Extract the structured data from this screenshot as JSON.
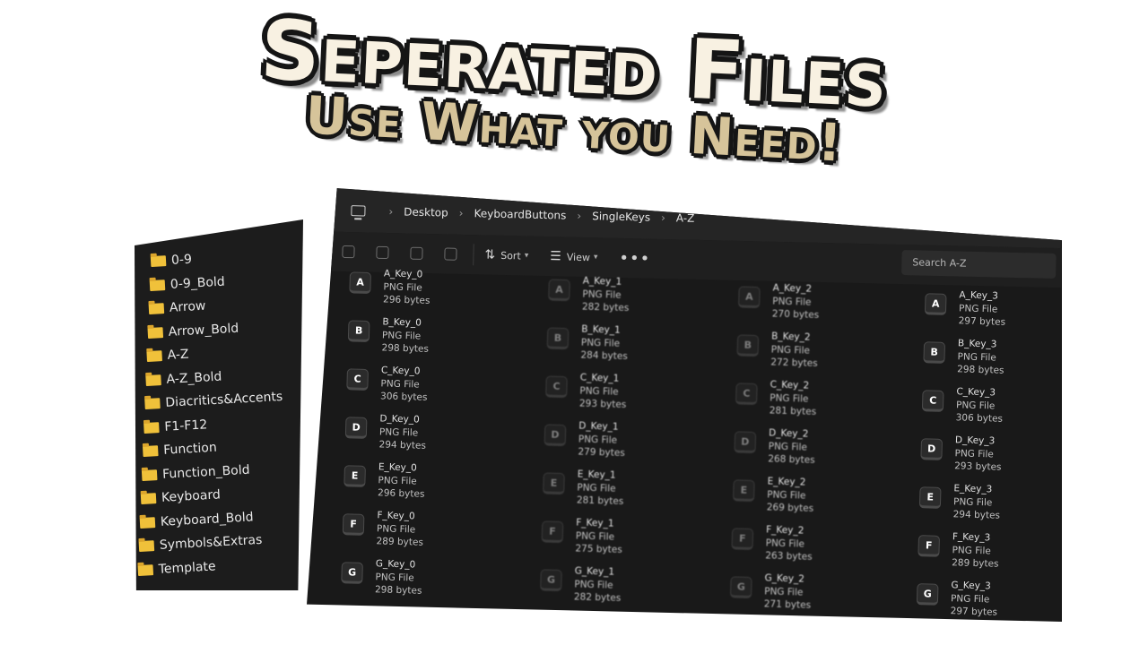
{
  "headline": {
    "title": "Seperated Files",
    "subtitle": "Use What you Need!"
  },
  "folders": [
    "0-9",
    "0-9_Bold",
    "Arrow",
    "Arrow_Bold",
    "A-Z",
    "A-Z_Bold",
    "Diacritics&Accents",
    "F1-F12",
    "Function",
    "Function_Bold",
    "Keyboard",
    "Keyboard_Bold",
    "Symbols&Extras",
    "Template"
  ],
  "explorer": {
    "breadcrumb": [
      "Desktop",
      "KeyboardButtons",
      "SingleKeys",
      "A-Z"
    ],
    "toolbar": {
      "sort": "Sort",
      "view": "View",
      "more": "•••"
    },
    "search_placeholder": "Search A-Z",
    "columns": [
      {
        "files": [
          {
            "letter": "A",
            "name": "A_Key_0",
            "type": "PNG File",
            "size": "296 bytes"
          },
          {
            "letter": "B",
            "name": "B_Key_0",
            "type": "PNG File",
            "size": "298 bytes"
          },
          {
            "letter": "C",
            "name": "C_Key_0",
            "type": "PNG File",
            "size": "306 bytes"
          },
          {
            "letter": "D",
            "name": "D_Key_0",
            "type": "PNG File",
            "size": "294 bytes"
          },
          {
            "letter": "E",
            "name": "E_Key_0",
            "type": "PNG File",
            "size": "296 bytes"
          },
          {
            "letter": "F",
            "name": "F_Key_0",
            "type": "PNG File",
            "size": "289 bytes"
          },
          {
            "letter": "G",
            "name": "G_Key_0",
            "type": "PNG File",
            "size": "298 bytes"
          }
        ]
      },
      {
        "files": [
          {
            "letter": "A",
            "name": "A_Key_1",
            "type": "PNG File",
            "size": "282 bytes"
          },
          {
            "letter": "B",
            "name": "B_Key_1",
            "type": "PNG File",
            "size": "284 bytes"
          },
          {
            "letter": "C",
            "name": "C_Key_1",
            "type": "PNG File",
            "size": "293 bytes"
          },
          {
            "letter": "D",
            "name": "D_Key_1",
            "type": "PNG File",
            "size": "279 bytes"
          },
          {
            "letter": "E",
            "name": "E_Key_1",
            "type": "PNG File",
            "size": "281 bytes"
          },
          {
            "letter": "F",
            "name": "F_Key_1",
            "type": "PNG File",
            "size": "275 bytes"
          },
          {
            "letter": "G",
            "name": "G_Key_1",
            "type": "PNG File",
            "size": "282 bytes"
          }
        ]
      },
      {
        "files": [
          {
            "letter": "A",
            "name": "A_Key_2",
            "type": "PNG File",
            "size": "270 bytes"
          },
          {
            "letter": "B",
            "name": "B_Key_2",
            "type": "PNG File",
            "size": "272 bytes"
          },
          {
            "letter": "C",
            "name": "C_Key_2",
            "type": "PNG File",
            "size": "281 bytes"
          },
          {
            "letter": "D",
            "name": "D_Key_2",
            "type": "PNG File",
            "size": "268 bytes"
          },
          {
            "letter": "E",
            "name": "E_Key_2",
            "type": "PNG File",
            "size": "269 bytes"
          },
          {
            "letter": "F",
            "name": "F_Key_2",
            "type": "PNG File",
            "size": "263 bytes"
          },
          {
            "letter": "G",
            "name": "G_Key_2",
            "type": "PNG File",
            "size": "271 bytes"
          }
        ]
      },
      {
        "files": [
          {
            "letter": "A",
            "name": "A_Key_3",
            "type": "PNG File",
            "size": "297 bytes"
          },
          {
            "letter": "B",
            "name": "B_Key_3",
            "type": "PNG File",
            "size": "298 bytes"
          },
          {
            "letter": "C",
            "name": "C_Key_3",
            "type": "PNG File",
            "size": "306 bytes"
          },
          {
            "letter": "D",
            "name": "D_Key_3",
            "type": "PNG File",
            "size": "293 bytes"
          },
          {
            "letter": "E",
            "name": "E_Key_3",
            "type": "PNG File",
            "size": "294 bytes"
          },
          {
            "letter": "F",
            "name": "F_Key_3",
            "type": "PNG File",
            "size": "289 bytes"
          },
          {
            "letter": "G",
            "name": "G_Key_3",
            "type": "PNG File",
            "size": "297 bytes"
          }
        ]
      }
    ]
  },
  "colors": {
    "title": "#f8f1e2",
    "subtitle": "#d6c49a",
    "window_bg": "#191919",
    "folder_icon": "#f0c13a"
  }
}
